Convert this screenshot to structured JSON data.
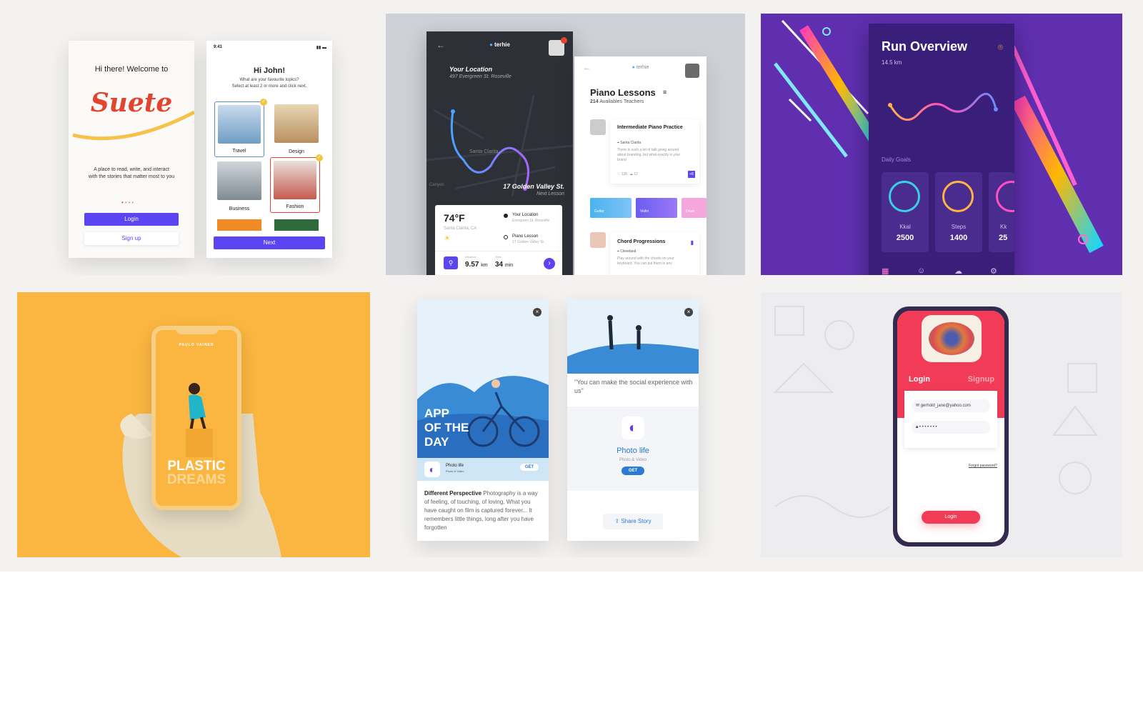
{
  "tile1": {
    "welcome_title": "Hi there! Welcome to",
    "logo_text": "Suete",
    "tagline_line1": "A place to read, write, and interact",
    "tagline_line2": "with the stories that matter most to you",
    "login_label": "Login",
    "signup_label": "Sign up",
    "status_time": "9:41",
    "greeting": "Hi John!",
    "question_line1": "What are your favourite topics?",
    "question_line2": "Select at least 2 or more and click next.",
    "topics": [
      {
        "label": "Travel",
        "color": "#8bb6d8"
      },
      {
        "label": "Design",
        "color": "#d8b07a"
      },
      {
        "label": "Business",
        "color": "#9aa5ad"
      },
      {
        "label": "Fashion",
        "color": "#c65a4f"
      }
    ],
    "next_label": "Next"
  },
  "tile2": {
    "brand": "terhie",
    "location_title": "Your Location",
    "location_address": "497 Evergreen St. Roseville",
    "map_place": "Santa Clarita",
    "map_place2": "Canyon",
    "destination": "17 Golden Valley St.",
    "next_lesson": "Next Lesson",
    "temperature": "74°F",
    "weather_city": "Santa Clarita, CA",
    "stop1_title": "Your Location",
    "stop1_sub": "Evergreen St. Roseville",
    "stop2_title": "Piano Lesson",
    "stop2_sub": "17 Golden Valley St.",
    "distance_label": "Distance",
    "distance_value": "9.57",
    "distance_unit": "km",
    "time_label": "Time",
    "time_value": "34",
    "time_unit": "min",
    "lessons_title": "Piano Lessons",
    "teachers_count": "214",
    "teachers_label": "Availables Teachers",
    "lesson1_title": "Intermediate Piano Practice",
    "lesson1_place": "Santa Clarita",
    "lesson1_desc": "There is such a lot of talk going around about branding, but what exactly is your brand",
    "likes": "135",
    "comments": "12",
    "extra_count": "+8",
    "chips": [
      "Guitar",
      "Violin",
      "Drum"
    ],
    "lesson2_title": "Chord Progressions",
    "lesson2_place": "Cleveland",
    "lesson2_desc": "Play around with the chords on your keyboard. You can put them in any"
  },
  "tile3": {
    "title": "Run Overview",
    "distance": "14.5 km",
    "daily_goals_label": "Daily Goals",
    "goals": [
      {
        "label": "Kkal",
        "value": "2500",
        "color": "#39d0e6"
      },
      {
        "label": "Steps",
        "value": "1400",
        "color": "#ffb347"
      },
      {
        "label": "Kk",
        "value": "25",
        "color": "#ff4fc0"
      }
    ]
  },
  "tile4": {
    "phone_header": "PAULO VAINER",
    "title_line1": "PLASTIC",
    "title_line2": "DREAMS"
  },
  "tile5": {
    "hero_line1": "APP",
    "hero_line2": "OF THE",
    "hero_line3": "DAY",
    "app_name": "Photo life",
    "app_category": "Photo & Video",
    "get_label": "GET",
    "article_heading": "Different Perspective",
    "article_body": "Photography is a way of feeling, of touching, of loving. What you have caught on film is captured forever... It remembers little things, long after you have forgotten",
    "quote": "\"You can make the social experience with us\"",
    "app_name2": "Photo life",
    "app_category2": "Photo & Video",
    "get_label2": "GET",
    "share_label": "Share Story"
  },
  "tile6": {
    "login_tab": "Login",
    "signup_tab": "Signup",
    "email": "gerhold_jane@yahoo.com",
    "password_mask": "• • • • • • •",
    "forgot": "Forgot password?",
    "login_button": "Login"
  }
}
